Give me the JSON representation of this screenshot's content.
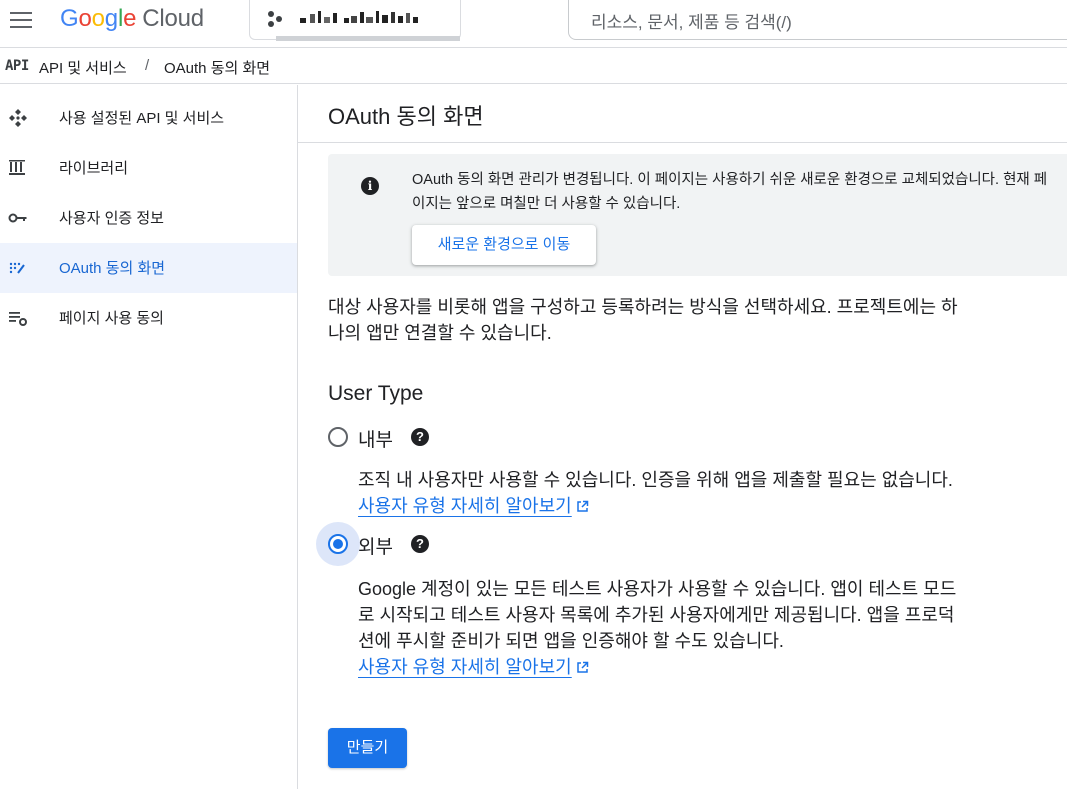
{
  "topbar": {
    "logo_parts": [
      "G",
      "o",
      "o",
      "g",
      "l",
      "e"
    ],
    "logo_product": "Cloud",
    "search_placeholder": "리소스, 문서, 제품 등 검색(/)"
  },
  "breadcrumb": {
    "icon_text": "API",
    "parent": "API 및 서비스",
    "separator": "/",
    "current": "OAuth 동의 화면"
  },
  "sidebar": {
    "items": [
      {
        "label": "사용 설정된 API 및 서비스",
        "icon": "api-services-icon",
        "active": false
      },
      {
        "label": "라이브러리",
        "icon": "library-icon",
        "active": false
      },
      {
        "label": "사용자 인증 정보",
        "icon": "key-icon",
        "active": false
      },
      {
        "label": "OAuth 동의 화면",
        "icon": "oauth-consent-icon",
        "active": true
      },
      {
        "label": "페이지 사용 동의",
        "icon": "page-usage-agreement-icon",
        "active": false
      }
    ]
  },
  "main": {
    "title": "OAuth 동의 화면",
    "banner": {
      "text": "OAuth 동의 화면 관리가 변경됩니다. 이 페이지는 사용하기 쉬운 새로운 환경으로 교체되었습니다. 현재 페이지는 앞으로 며칠만 더 사용할 수 있습니다.",
      "button_label": "새로운 환경으로 이동"
    },
    "intro": "대상 사용자를 비롯해 앱을 구성하고 등록하려는 방식을 선택하세요. 프로젝트에는 하나의 앱만 연결할 수 있습니다.",
    "user_type": {
      "title": "User Type",
      "options": [
        {
          "label": "내부",
          "checked": false,
          "description": "조직 내 사용자만 사용할 수 있습니다. 인증을 위해 앱을 제출할 필요는 없습니다.",
          "link": "사용자 유형 자세히 알아보기"
        },
        {
          "label": "외부",
          "checked": true,
          "description": "Google 계정이 있는 모든 테스트 사용자가 사용할 수 있습니다. 앱이 테스트 모드로 시작되고 테스트 사용자 목록에 추가된 사용자에게만 제공됩니다. 앱을 프로덕션에 푸시할 준비가 되면 앱을 인증해야 할 수도 있습니다.",
          "link": "사용자 유형 자세히 알아보기"
        }
      ]
    },
    "create_label": "만들기"
  },
  "colors": {
    "accent": "#1a73e8",
    "active_nav_bg": "#eef3fd",
    "banner_bg": "#f1f3f4"
  }
}
